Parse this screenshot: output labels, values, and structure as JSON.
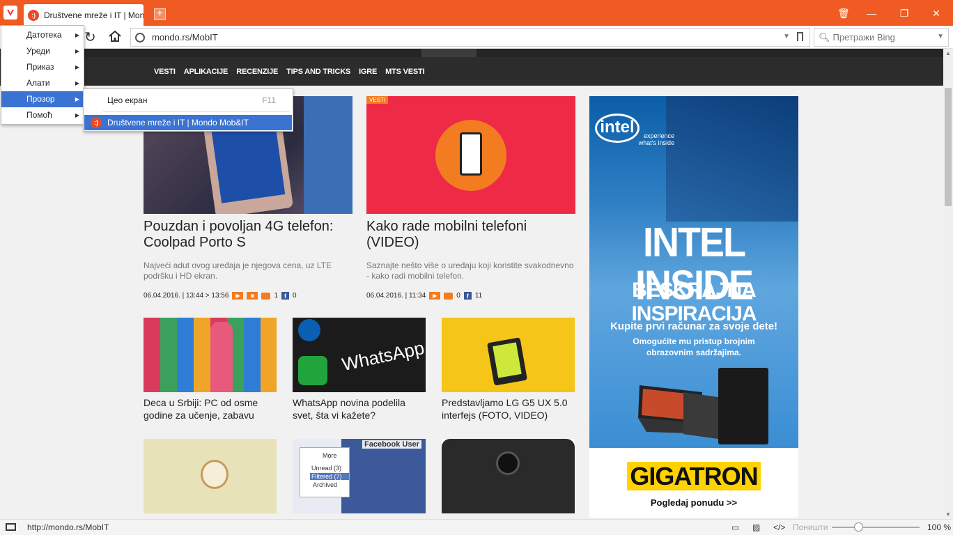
{
  "tab": {
    "title": "Društvene mreže i IT | Mondo Mob&IT"
  },
  "address": {
    "url": "mondo.rs/MobIT"
  },
  "search": {
    "placeholder": "Претражи Bing"
  },
  "site_nav": [
    "VESTI",
    "APLIKACIJE",
    "RECENZIJE",
    "TIPS AND TRICKS",
    "IGRE",
    "MTS VESTI"
  ],
  "articles": {
    "a1": {
      "title": "Pouzdan i povoljan 4G telefon: Coolpad Porto S",
      "summary": "Najveći adut ovog uređaja je njegova cena, uz LTE podršku i HD ekran.",
      "date": "06.04.2016. | 13:44  >  13:56",
      "comments": "1",
      "fb": "0"
    },
    "a2": {
      "badge": "VESTI",
      "title": "Kako rade mobilni telefoni (VIDEO)",
      "summary": "Saznajte nešto više o uređaju koji koristite svakodnevno - kako radi mobilni telefon.",
      "date": "06.04.2016. | 11:34",
      "comments": "0",
      "fb": "11"
    },
    "s1": "Deca u Srbiji: PC od osme godine za učenje, zabavu",
    "s2": "WhatsApp novina podelila svet, šta vi kažete?",
    "s3": "Predstavljamo LG G5 UX 5.0 interfejs (FOTO, VIDEO)",
    "thumb_texts": {
      "whatsapp": "WhatsApp",
      "fb_user": "Facebook User",
      "more": "More",
      "unread": "Unread (3)",
      "filtered": "Filtered (7)",
      "archived": "Archived"
    }
  },
  "ad": {
    "logo": "intel",
    "tagline": "experience what's inside",
    "headline": "INTEL INSIDE",
    "headline2": "BESKRAJNA INSPIRACIJA",
    "cta": "Kupite prvi računar za svoje dete!",
    "cta2": "Omogućite mu pristup brojnim obrazovnim sadržajima.",
    "brand": "GIGATRON",
    "more": "Pogledaj ponudu >>"
  },
  "menu": {
    "items": [
      "Датотека",
      "Уреди",
      "Приказ",
      "Алати",
      "Прозор",
      "Помоћ"
    ],
    "submenu": {
      "fullscreen": "Цео екран",
      "fullscreen_key": "F11",
      "window": "Društvene mreže i IT | Mondo Mob&IT"
    }
  },
  "status": {
    "url": "http://mondo.rs/MobIT",
    "reset": "Поништи",
    "zoom": "100 %"
  },
  "colors": {
    "accent": "#ef5b22",
    "menu_highlight": "#3b73d3",
    "site_nav": "#2c2c2c"
  }
}
